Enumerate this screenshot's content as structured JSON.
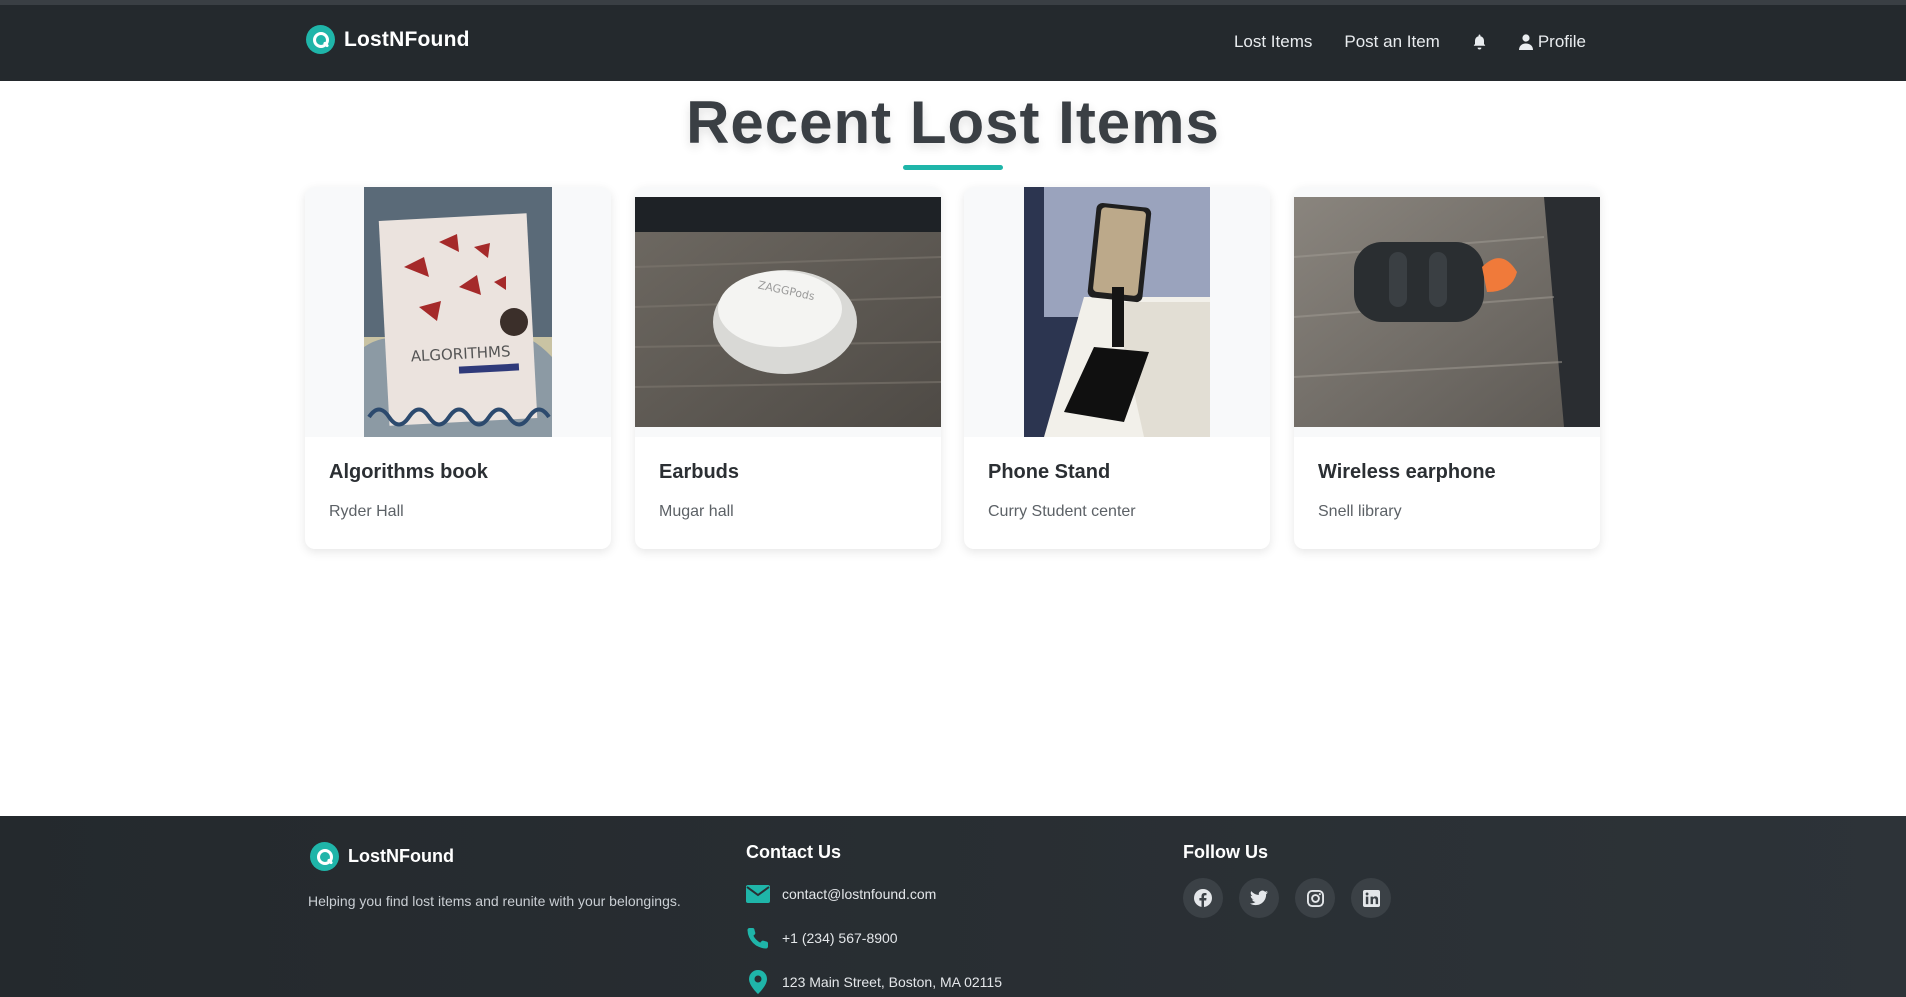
{
  "navbar": {
    "brand": "LostNFound",
    "links": [
      {
        "label": "Lost Items"
      },
      {
        "label": "Post an Item"
      },
      {
        "label": "Profile"
      }
    ],
    "icons": [
      "bell-icon",
      "user-icon"
    ]
  },
  "main": {
    "title": "Recent Lost Items",
    "cards": [
      {
        "title": "Algorithms book",
        "location": "Ryder Hall",
        "image": "photo of Introduction to Algorithms book"
      },
      {
        "title": "Earbuds",
        "location": "Mugar hall",
        "image": "photo of white earbuds case"
      },
      {
        "title": "Phone Stand",
        "location": "Curry Student center",
        "image": "photo of black phone stand"
      },
      {
        "title": "Wireless earphone",
        "location": "Snell library",
        "image": "photo of black earphone case"
      }
    ]
  },
  "footer": {
    "brand": "LostNFound",
    "tagline": "Helping you find lost items and reunite with your belongings.",
    "contact_heading": "Contact Us",
    "email": "contact@lostnfound.com",
    "phone": "+1 (234) 567-8900",
    "address": "123 Main Street, Boston, MA 02115",
    "follow_heading": "Follow Us",
    "socials": [
      "facebook-icon",
      "twitter-icon",
      "instagram-icon",
      "linkedin-icon"
    ]
  },
  "colors": {
    "accent": "#1fb5a9",
    "navbar": "#24292d",
    "footer": "#24292d"
  }
}
